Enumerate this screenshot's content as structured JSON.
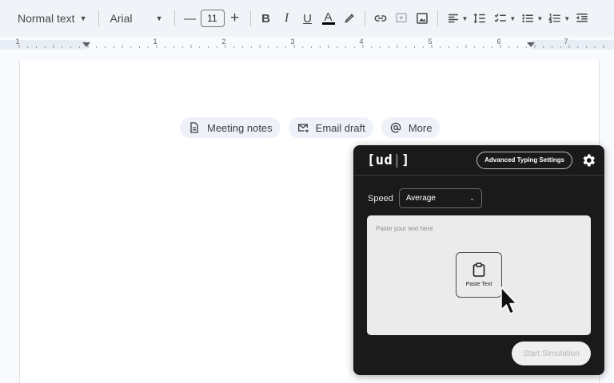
{
  "toolbar": {
    "style_label": "Normal text",
    "font_label": "Arial",
    "font_size": "11",
    "decrease_symbol": "—",
    "increase_symbol": "+",
    "bold_label": "B",
    "italic_label": "I",
    "underline_label": "U",
    "text_color_label": "A",
    "icons": [
      "highlight-icon",
      "link-icon",
      "add-comment-icon",
      "insert-image-icon",
      "align-icon",
      "line-spacing-icon",
      "checklist-icon",
      "bulleted-list-icon",
      "numbered-list-icon",
      "decrease-indent-icon"
    ]
  },
  "ruler": {
    "numbers": [
      "1",
      "1",
      "2",
      "3",
      "4",
      "5",
      "6",
      "7"
    ]
  },
  "doc": {
    "chips": [
      {
        "label": "Meeting notes",
        "icon": "document-icon"
      },
      {
        "label": "Email draft",
        "icon": "email-icon"
      },
      {
        "label": "More",
        "icon": "at-icon"
      }
    ]
  },
  "panel": {
    "logo": "[ud",
    "logo_cursor": "|",
    "logo_close": "]",
    "advanced_label": "Advanced Typing Settings",
    "speed_label": "Speed",
    "speed_value": "Average",
    "text_placeholder": "Paste your text here",
    "paste_label": "Paste Text",
    "start_label": "Start Simulation",
    "colors": {
      "panel_bg": "#1a1a1a",
      "textarea_bg": "#ebebeb",
      "accent": "#ffffff"
    }
  }
}
